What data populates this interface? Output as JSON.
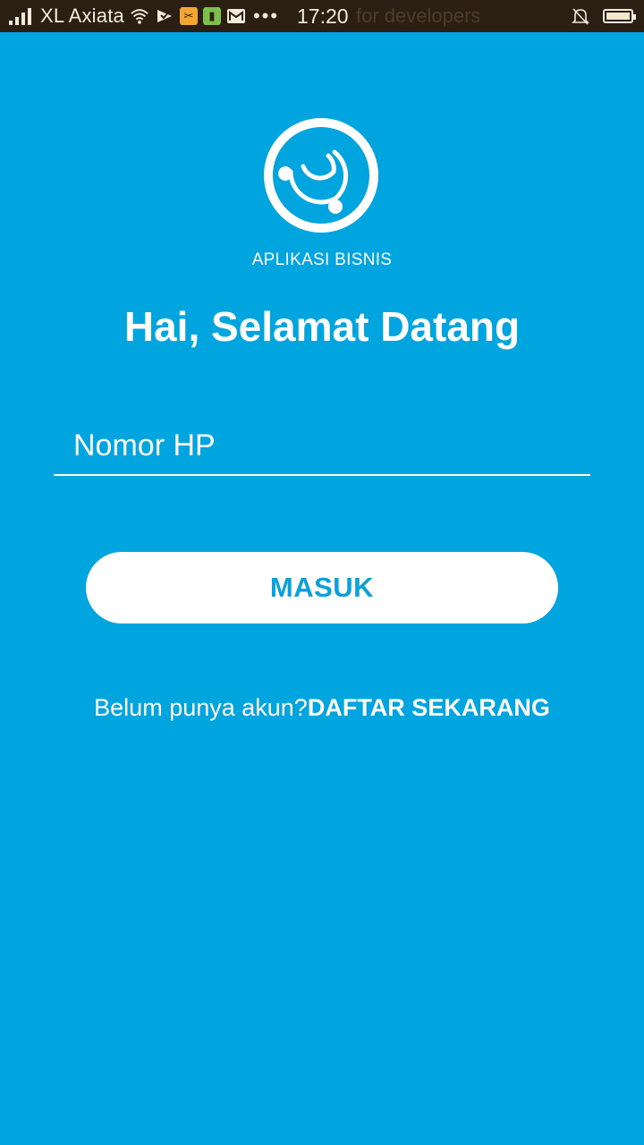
{
  "status_bar": {
    "carrier": "XL Axiata",
    "time": "17:20",
    "background_text": "for developers",
    "icons": [
      "signal-icon",
      "wifi-icon",
      "notification-app-icon",
      "app-icon-orange",
      "battery-saver-icon",
      "mail-icon",
      "more-dots-icon",
      "silent-bell-icon",
      "battery-icon"
    ],
    "dots": "•••"
  },
  "brand": {
    "caption": "APLIKASI BISNIS"
  },
  "login": {
    "title": "Hai, Selamat Datang",
    "phone_placeholder": "Nomor HP",
    "phone_value": "",
    "submit_label": "MASUK"
  },
  "register": {
    "prompt": "Belum punya akun?",
    "link_label": "DAFTAR SEKARANG"
  },
  "colors": {
    "background": "#00a5df",
    "status_bar": "#2a1f12",
    "button_text": "#0aa0d8"
  }
}
